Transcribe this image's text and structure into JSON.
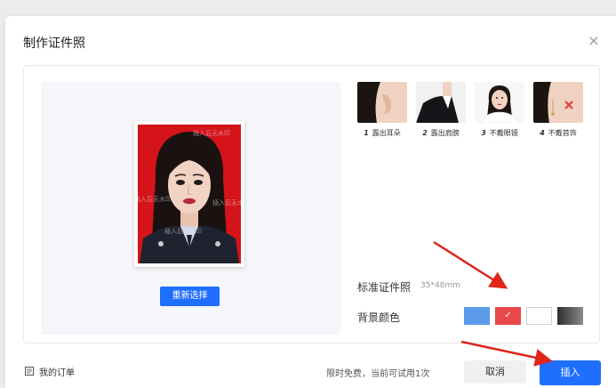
{
  "dialog": {
    "title": "制作证件照",
    "close_symbol": "×"
  },
  "preview": {
    "watermark": "插入后无水印",
    "reselect_label": "重新选择"
  },
  "tips": [
    {
      "num": "1",
      "label": "露出耳朵",
      "icon": "ear"
    },
    {
      "num": "2",
      "label": "露出肩膀",
      "icon": "shoulder"
    },
    {
      "num": "3",
      "label": "不戴眼镜",
      "icon": "no-glasses"
    },
    {
      "num": "4",
      "label": "不戴首饰",
      "icon": "no-jewelry"
    }
  ],
  "spec": {
    "label": "标准证件照",
    "size": "35*48mm"
  },
  "background": {
    "label": "背景颜色",
    "selected": "red",
    "swatches": [
      {
        "name": "blue",
        "color": "#5b9bea"
      },
      {
        "name": "red",
        "color": "#e8484a"
      },
      {
        "name": "white",
        "color": "#ffffff"
      },
      {
        "name": "gradient-gray",
        "color": "#4a4a4a"
      }
    ],
    "check_symbol": "✓"
  },
  "footer": {
    "orders_label": "我的订单",
    "trial_note": "限时免费，当前可试用1次",
    "cancel_label": "取消",
    "insert_label": "插入"
  },
  "colors": {
    "accent": "#1f6fff",
    "annotation_arrow": "#e0251b",
    "photo_background": "#d4131b"
  }
}
